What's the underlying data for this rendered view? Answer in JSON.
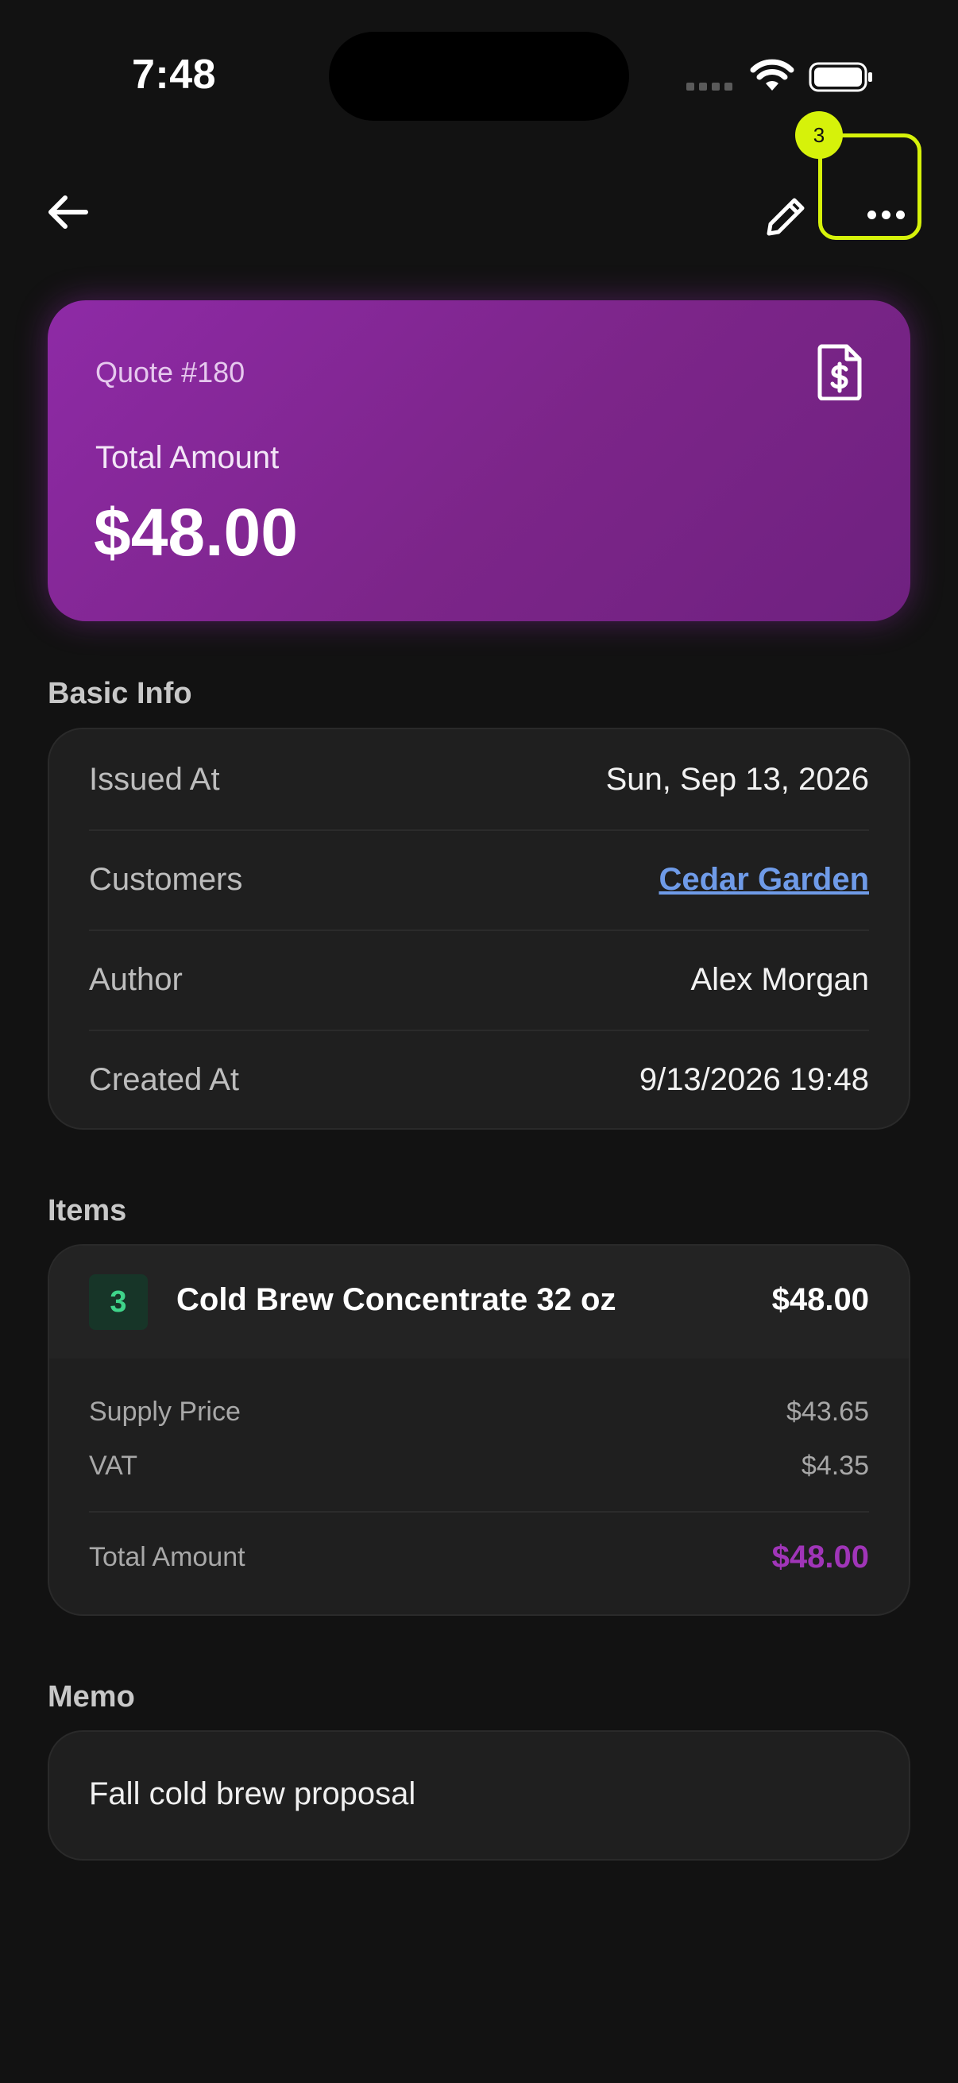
{
  "status_bar": {
    "time": "7:48"
  },
  "toolbar": {
    "badge_count": "3"
  },
  "hero": {
    "quote_number": "Quote #180",
    "label": "Total Amount",
    "amount": "$48.00"
  },
  "basic_info": {
    "title": "Basic Info",
    "rows": [
      {
        "label": "Issued At",
        "value": "Sun, Sep 13, 2026"
      },
      {
        "label": "Customers",
        "value": "Cedar Garden"
      },
      {
        "label": "Author",
        "value": "Alex Morgan"
      },
      {
        "label": "Created At",
        "value": "9/13/2026 19:48"
      }
    ]
  },
  "items": {
    "title": "Items",
    "list": [
      {
        "quantity": "3",
        "name": "Cold Brew Concentrate 32 oz",
        "price": "$48.00",
        "supply_price_label": "Supply Price",
        "supply_price": "$43.65",
        "vat_label": "VAT",
        "vat": "$4.35",
        "total_label": "Total Amount",
        "total": "$48.00"
      }
    ]
  },
  "memo": {
    "title": "Memo",
    "text": "Fall cold brew proposal"
  },
  "colors": {
    "hero_gradient_start": "#8e2aa6",
    "hero_gradient_end": "#6f2180",
    "highlight": "#d6f20a",
    "link": "#6f9be8",
    "total_accent": "#a035b8",
    "qty_green": "#3fd48a"
  },
  "icons": [
    "back-arrow-icon",
    "pencil-icon",
    "more-horizontal-icon",
    "invoice-dollar-icon",
    "wifi-icon",
    "battery-icon",
    "signal-icon"
  ]
}
